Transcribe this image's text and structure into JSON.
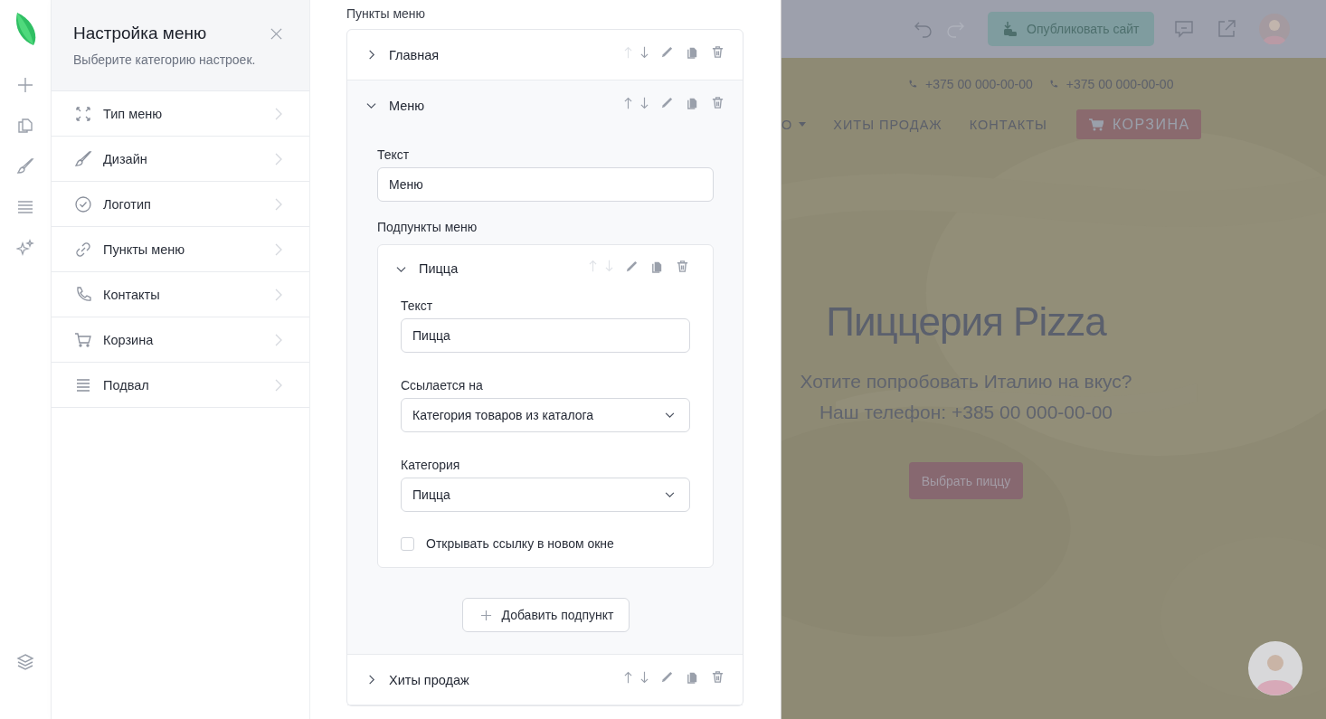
{
  "settings_panel": {
    "title": "Настройка меню",
    "subtitle": "Выберите категорию настроек.",
    "categories": [
      {
        "label": "Тип меню"
      },
      {
        "label": "Дизайн"
      },
      {
        "label": "Логотип"
      },
      {
        "label": "Пункты меню"
      },
      {
        "label": "Контакты"
      },
      {
        "label": "Корзина"
      },
      {
        "label": "Подвал"
      }
    ]
  },
  "editor": {
    "section_title": "Пункты меню",
    "items": [
      {
        "label": "Главная",
        "expanded": false,
        "up_disabled": true,
        "down_disabled": false
      },
      {
        "label": "Меню",
        "expanded": true,
        "up_disabled": false,
        "down_disabled": false,
        "text_label": "Текст",
        "text_value": "Меню",
        "subitems_label": "Подпункты меню",
        "add_button": "Добавить подпункт",
        "subitems": [
          {
            "label": "Пицца",
            "expanded": true,
            "up_disabled": true,
            "down_disabled": true,
            "fields": [
              {
                "kind": "text",
                "label": "Текст",
                "value": "Пицца"
              },
              {
                "kind": "select",
                "label": "Ссылается на",
                "value": "Категория товаров из каталога"
              },
              {
                "kind": "select",
                "label": "Категория",
                "value": "Пицца"
              }
            ],
            "new_window": {
              "label": "Открывать ссылку в новом окне",
              "checked": false
            }
          }
        ]
      },
      {
        "label": "Хиты продаж",
        "expanded": false,
        "up_disabled": false,
        "down_disabled": false
      }
    ]
  },
  "preview": {
    "toolbar": {
      "undo_disabled": false,
      "redo_disabled": true,
      "publish_button": "Опубликовать сайт"
    },
    "phones": [
      "+375 00 000-00-00",
      "+375 00 000-00-00"
    ],
    "nav": [
      {
        "label": "О",
        "dropdown": true
      },
      {
        "label": "ХИТЫ ПРОДАЖ",
        "dropdown": false
      },
      {
        "label": "КОНТАКТЫ",
        "dropdown": false
      }
    ],
    "cart_button": "КОРЗИНА",
    "hero_title": "Пиццерия Pizza",
    "hero_lines": [
      "Хотите попробовать Италию на вкус?",
      "Наш телефон: +385 00 000-00-00"
    ],
    "cta_button": "Выбрать пиццу"
  }
}
